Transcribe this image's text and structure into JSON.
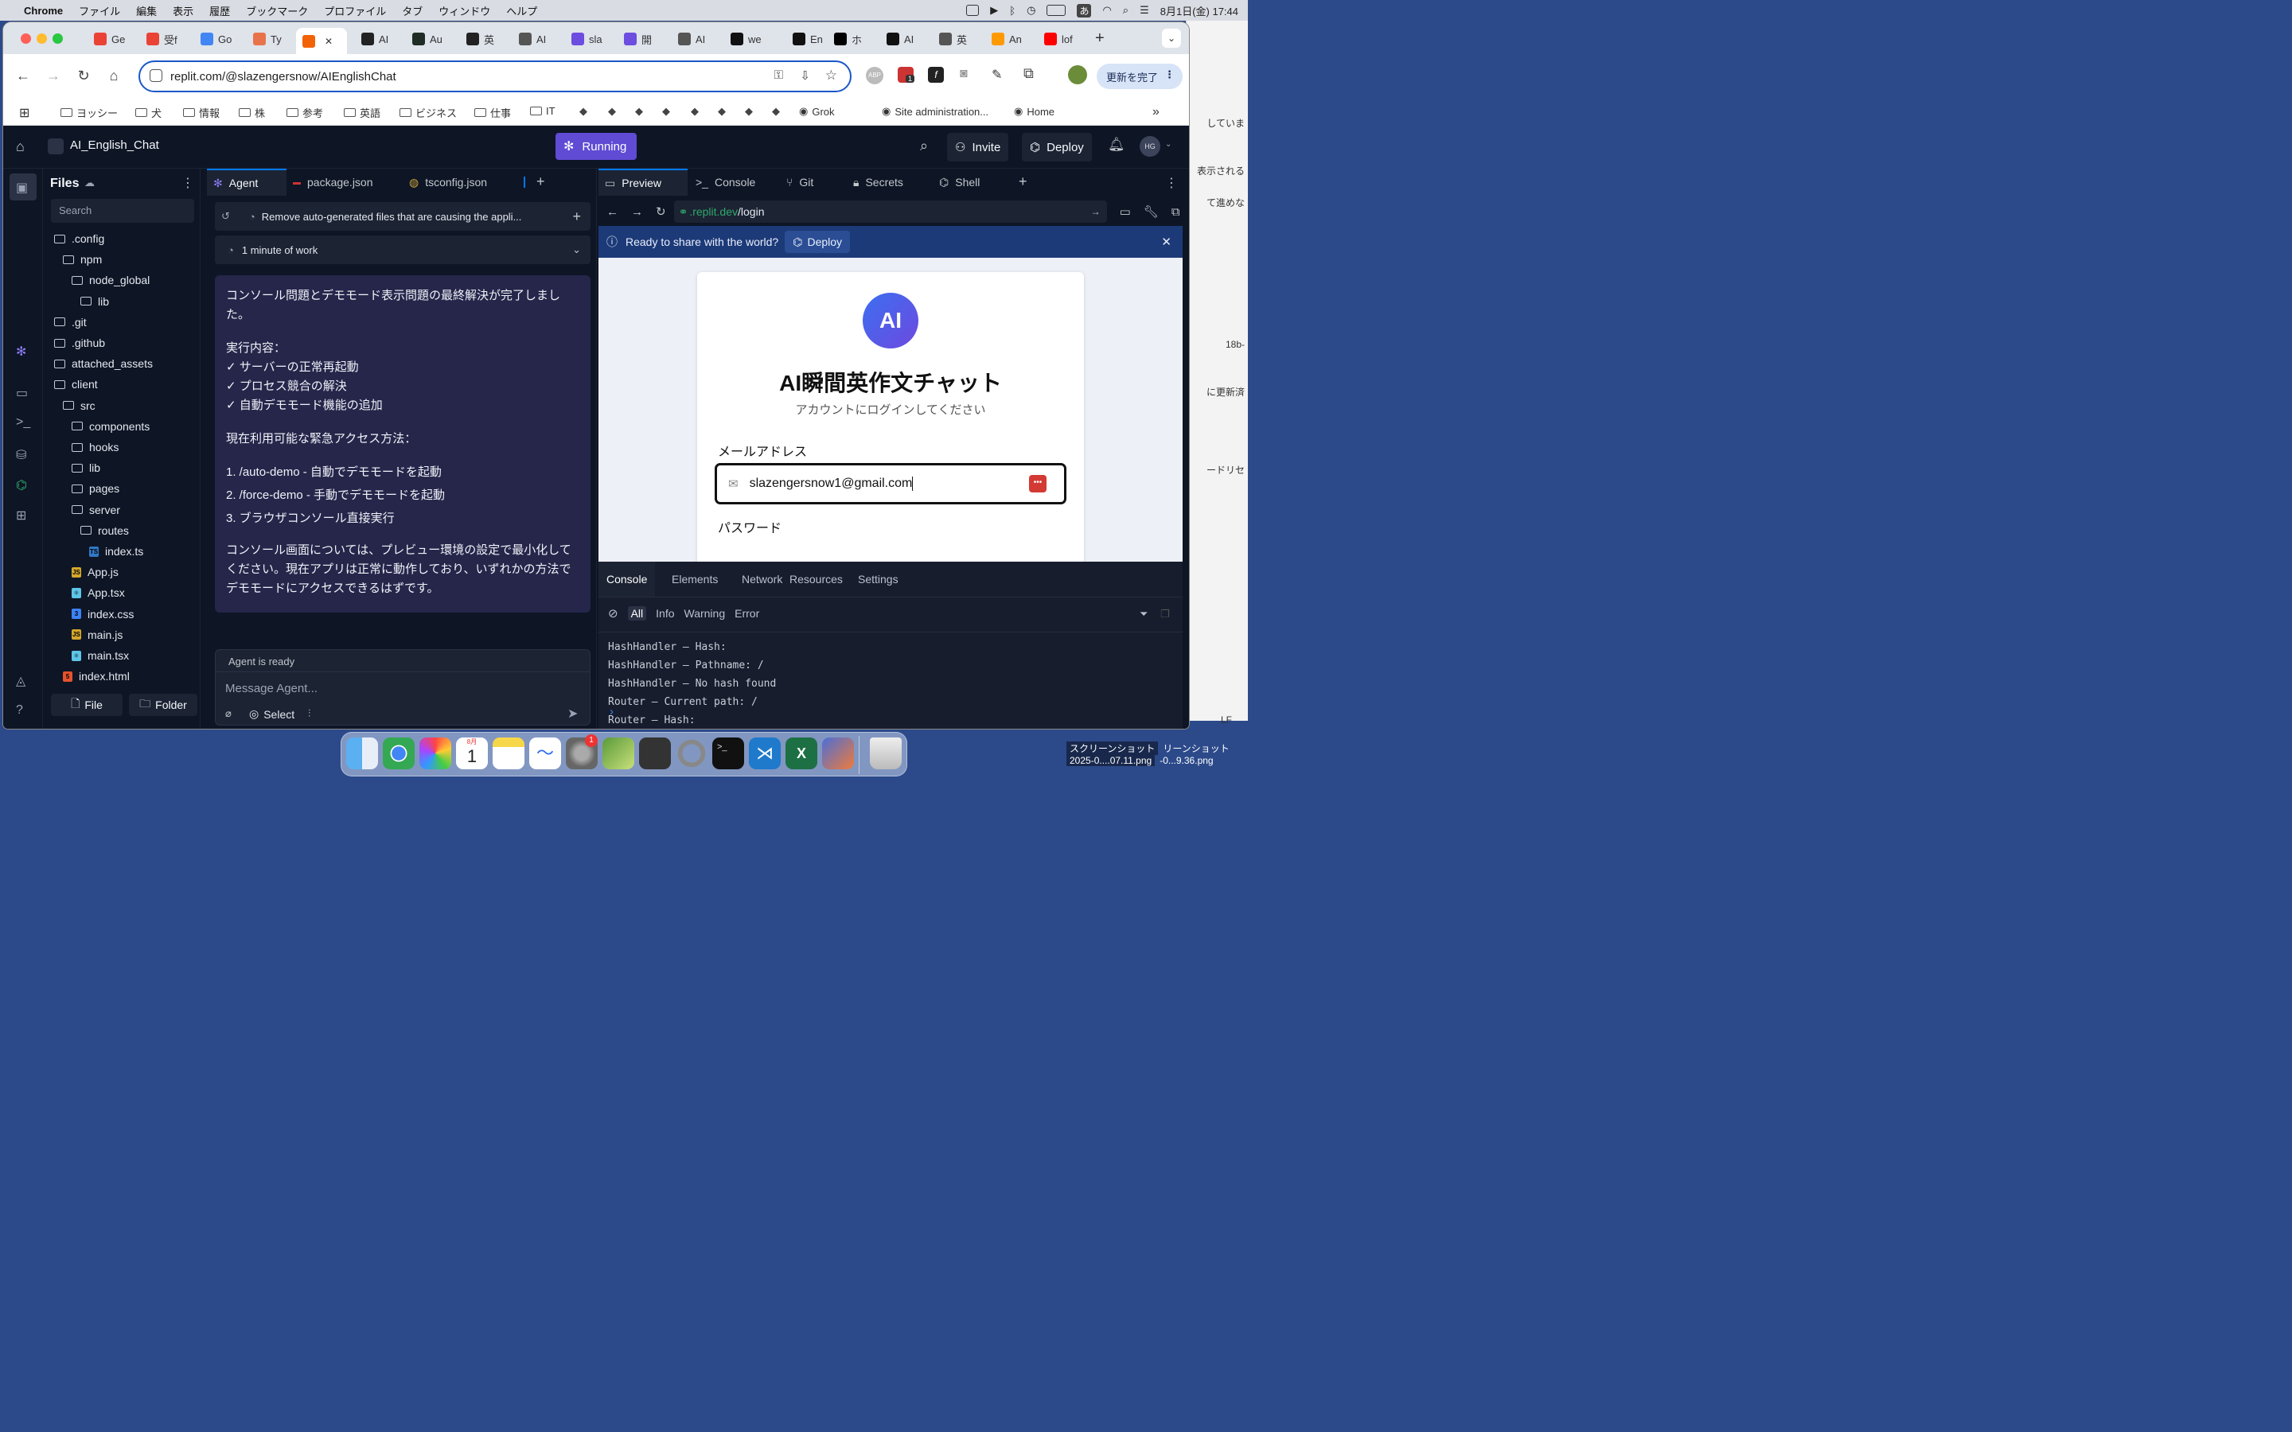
{
  "menubar": {
    "app": "Chrome",
    "items": [
      "ファイル",
      "編集",
      "表示",
      "履歴",
      "ブックマーク",
      "プロファイル",
      "タブ",
      "ウィンドウ",
      "ヘルプ"
    ],
    "ime": "あ",
    "datetime": "8月1日(金)  17:44"
  },
  "tabs": [
    {
      "label": "Ge",
      "color": "#ea4335"
    },
    {
      "label": "受f",
      "color": "#ea4335"
    },
    {
      "label": "Go",
      "color": "#4285f4"
    },
    {
      "label": "Ty",
      "color": "#e8734a"
    },
    {
      "label": "",
      "color": "#f26207",
      "active": true
    },
    {
      "label": "AI",
      "color": "#222"
    },
    {
      "label": "Au",
      "color": "#1f2d24"
    },
    {
      "label": "英",
      "color": "#222"
    },
    {
      "label": "AI",
      "color": "#555"
    },
    {
      "label": "sla",
      "color": "#6d4ce0"
    },
    {
      "label": "開",
      "color": "#6d4ce0"
    },
    {
      "label": "AI",
      "color": "#555"
    },
    {
      "label": "we",
      "color": "#111"
    },
    {
      "label": "En",
      "color": "#111"
    },
    {
      "label": "ホ",
      "color": "#000"
    },
    {
      "label": "AI",
      "color": "#111"
    },
    {
      "label": "英",
      "color": "#555"
    },
    {
      "label": "An",
      "color": "#ff9900"
    },
    {
      "label": "lof",
      "color": "#ff0000"
    }
  ],
  "toolbar": {
    "url": "replit.com/@slazengersnow/AIEnglishChat",
    "update_button": "更新を完了",
    "ext_badge": "1"
  },
  "bookmarks": [
    "ヨッシー",
    "犬",
    "情報",
    "株",
    "参考",
    "英語",
    "ビジネス",
    "仕事",
    "IT",
    "Grok",
    "Site administration...",
    "Home"
  ],
  "replit": {
    "project_name": "AI_English_Chat",
    "status": "Running",
    "invite": "Invite",
    "deploy": "Deploy",
    "avatar": "HG",
    "files": {
      "title": "Files",
      "search_placeholder": "Search",
      "new_file": "File",
      "new_folder": "Folder",
      "tree": [
        {
          "name": ".config",
          "depth": 0,
          "type": "folder"
        },
        {
          "name": "npm",
          "depth": 1,
          "type": "folder"
        },
        {
          "name": "node_global",
          "depth": 2,
          "type": "folder"
        },
        {
          "name": "lib",
          "depth": 3,
          "type": "folder"
        },
        {
          "name": ".git",
          "depth": 0,
          "type": "folder"
        },
        {
          "name": ".github",
          "depth": 0,
          "type": "folder"
        },
        {
          "name": "attached_assets",
          "depth": 0,
          "type": "folder"
        },
        {
          "name": "client",
          "depth": 0,
          "type": "folder"
        },
        {
          "name": "src",
          "depth": 1,
          "type": "folder"
        },
        {
          "name": "components",
          "depth": 2,
          "type": "folder"
        },
        {
          "name": "hooks",
          "depth": 2,
          "type": "folder"
        },
        {
          "name": "lib",
          "depth": 2,
          "type": "folder"
        },
        {
          "name": "pages",
          "depth": 2,
          "type": "folder"
        },
        {
          "name": "server",
          "depth": 2,
          "type": "folder"
        },
        {
          "name": "routes",
          "depth": 3,
          "type": "folder"
        },
        {
          "name": "index.ts",
          "depth": 4,
          "type": "ts"
        },
        {
          "name": "App.js",
          "depth": 2,
          "type": "js"
        },
        {
          "name": "App.tsx",
          "depth": 2,
          "type": "react"
        },
        {
          "name": "index.css",
          "depth": 2,
          "type": "css"
        },
        {
          "name": "main.js",
          "depth": 2,
          "type": "js"
        },
        {
          "name": "main.tsx",
          "depth": 2,
          "type": "react"
        },
        {
          "name": "index.html",
          "depth": 1,
          "type": "html"
        }
      ]
    },
    "editor_tabs": [
      "Agent",
      "package.json",
      "tsconfig.json"
    ],
    "agent": {
      "checkpoint": "Remove auto-generated files that are causing the appli...",
      "work": "1 minute of work",
      "message": {
        "intro": "コンソール問題とデモモード表示問題の最終解決が完了しました。",
        "done_head": "実行内容：",
        "done": [
          "✓ サーバーの正常再起動",
          "✓ プロセス競合の解決",
          "✓ 自動デモモード機能の追加"
        ],
        "methods_head": "現在利用可能な緊急アクセス方法：",
        "methods": [
          "1. /auto-demo - 自動でデモモードを起動",
          "2. /force-demo - 手動でデモモードを起動",
          "3. ブラウザコンソール直接実行"
        ],
        "outro": "コンソール画面については、プレビュー環境の設定で最小化してください。現在アプリは正常に動作しており、いずれかの方法でデモモードにアクセスできるはずです。"
      },
      "status": "Agent is ready",
      "input_placeholder": "Message Agent...",
      "select": "Select"
    },
    "preview_tabs": [
      "Preview",
      "Console",
      "Git",
      "Secrets",
      "Shell"
    ],
    "preview": {
      "url_host": ".replit.dev",
      "url_path": "/login",
      "share_text": "Ready to share with the world?",
      "share_deploy": "Deploy",
      "app": {
        "logo": "AI",
        "title": "AI瞬間英作文チャット",
        "subtitle": "アカウントにログインしてください",
        "email_label": "メールアドレス",
        "email_value": "slazengersnow1@gmail.com",
        "password_label": "パスワード"
      }
    },
    "devtools": {
      "tabs": [
        "Console",
        "Elements",
        "Network",
        "Resources",
        "Settings"
      ],
      "filters": [
        "All",
        "Info",
        "Warning",
        "Error"
      ],
      "logs": [
        "HashHandler – Hash:",
        "HashHandler – Pathname: /",
        "HashHandler – No hash found",
        "Router – Current path: /",
        "Router – Hash:"
      ]
    }
  },
  "background_window": {
    "lines": [
      "していま",
      "表示される",
      "て進めな",
      "18b-",
      "に更新済",
      "ードリセ",
      "LF"
    ]
  },
  "dock": {
    "calendar_month": "8月",
    "calendar_day": "1",
    "settings_badge": "1"
  },
  "screenshot_label": {
    "a": "スクリーンショット",
    "b": "リーンショット",
    "c": "2025-0....07.11.png",
    "d": "-0...9.36.png"
  }
}
